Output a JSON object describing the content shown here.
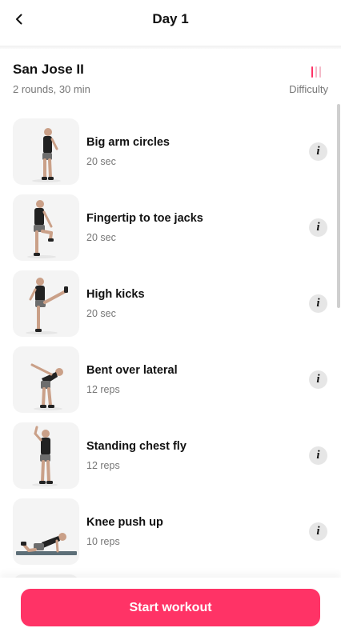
{
  "header": {
    "title": "Day 1",
    "back_icon": "chevron-left-icon"
  },
  "workout": {
    "name": "San Jose II",
    "meta": "2 rounds, 30 min",
    "difficulty_label": "Difficulty",
    "difficulty_level": 1,
    "difficulty_max": 3
  },
  "exercises": [
    {
      "name": "Big arm circles",
      "meta": "20 sec",
      "image": "arm-circles-image"
    },
    {
      "name": "Fingertip to toe jacks",
      "meta": "20 sec",
      "image": "toe-jacks-image"
    },
    {
      "name": "High kicks",
      "meta": "20 sec",
      "image": "high-kicks-image"
    },
    {
      "name": "Bent over lateral",
      "meta": "12 reps",
      "image": "bent-over-lateral-image"
    },
    {
      "name": "Standing chest fly",
      "meta": "12 reps",
      "image": "chest-fly-image"
    },
    {
      "name": "Knee push up",
      "meta": "10 reps",
      "image": "knee-push-up-image"
    }
  ],
  "info_icon": "info-icon",
  "footer": {
    "start_label": "Start workout"
  },
  "colors": {
    "accent": "#ff3366",
    "muted_text": "#777777",
    "thumb_bg": "#f4f4f4"
  }
}
